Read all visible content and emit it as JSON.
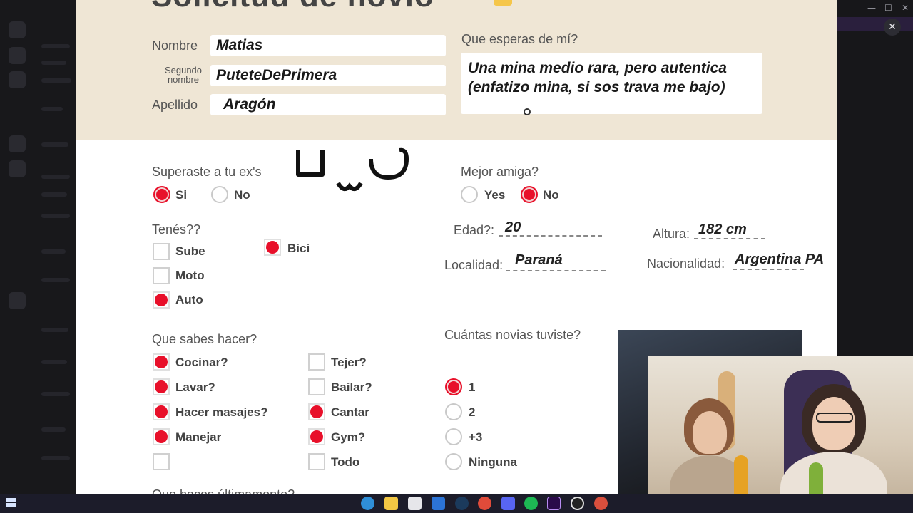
{
  "window": {
    "controls": [
      "—",
      "☐",
      "✕"
    ],
    "close_overlay": "✕"
  },
  "form": {
    "title": "Solicitud de novio",
    "nombre_label": "Nombre",
    "nombre_value": "Matias",
    "segundo_label": "Segundo nombre",
    "segundo_value": "PuteteDePrimera",
    "apellido_label": "Apellido",
    "apellido_value": "Aragón",
    "esperas_label": "Que esperas de mí?",
    "esperas_value_1": "Una mina medio rara, pero autentica",
    "esperas_value_2": "(enfatizo mina, si sos trava me bajo)",
    "superaste_label": "Superaste a tu ex's",
    "superaste_options": [
      "Si",
      "No"
    ],
    "superaste_selected": "Si",
    "uwu_doodle": "U ᴗ U",
    "mejor_amiga_label": "Mejor amiga?",
    "mejor_amiga_options": [
      "Yes",
      "No"
    ],
    "mejor_amiga_selected": "No",
    "tenes_label": "Tenés??",
    "tenes_options": [
      {
        "label": "Sube",
        "checked": false
      },
      {
        "label": "Moto",
        "checked": false
      },
      {
        "label": "Auto",
        "checked": true
      },
      {
        "label": "Bici",
        "checked": true
      }
    ],
    "edad_label": "Edad?:",
    "edad_value": "20",
    "altura_label": "Altura:",
    "altura_value": "182 cm",
    "localidad_label": "Localidad:",
    "localidad_value": "Paraná",
    "nacionalidad_label": "Nacionalidad:",
    "nacionalidad_value": "Argentina PA",
    "sabes_label": "Que sabes hacer?",
    "sabes_options": [
      {
        "label": "Cocinar?",
        "checked": true
      },
      {
        "label": "Lavar?",
        "checked": true
      },
      {
        "label": "Hacer masajes?",
        "checked": true
      },
      {
        "label": "Manejar",
        "checked": true
      },
      {
        "label": "",
        "checked": false
      },
      {
        "label": "Tejer?",
        "checked": false
      },
      {
        "label": "Bailar?",
        "checked": false
      },
      {
        "label": "Cantar",
        "checked": true
      },
      {
        "label": "Gym?",
        "checked": true
      },
      {
        "label": "Todo",
        "checked": false
      }
    ],
    "novias_label": "Cuántas novias tuviste?",
    "novias_options": [
      "1",
      "2",
      "+3",
      "Ninguna"
    ],
    "novias_selected": "1",
    "next_section_label": "Que haces últimamente?"
  },
  "taskbar": {
    "icons": [
      "windows-start-icon",
      "edge-icon",
      "file-explorer-icon",
      "store-icon",
      "mail-icon",
      "steam-icon",
      "chrome-icon",
      "discord-icon",
      "spotify-icon",
      "premiere-icon",
      "obs-icon",
      "chrome-alt-icon"
    ]
  },
  "colors": {
    "selected": "#e8102a",
    "header_bg": "#efe6d5",
    "taskbar_bg": "#1c1c2a"
  }
}
